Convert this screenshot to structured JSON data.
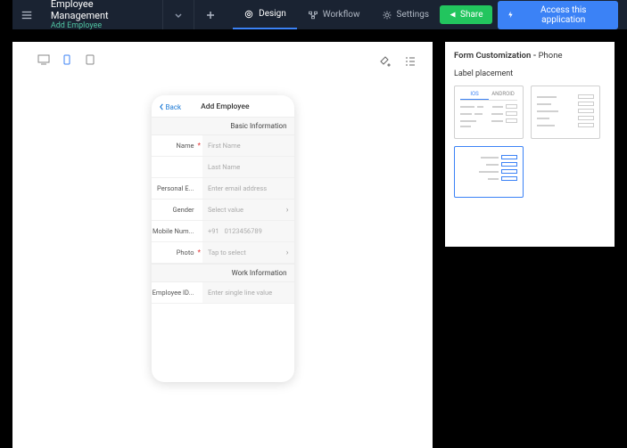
{
  "header": {
    "app_title": "Employee Management",
    "app_subtitle": "Add Employee",
    "tabs": {
      "design": "Design",
      "workflow": "Workflow",
      "settings": "Settings"
    },
    "share": "Share",
    "access": "Access this application"
  },
  "panel": {
    "title_prefix": "Form Customization - ",
    "title_context": "Phone",
    "label_placement": "Label placement",
    "tabs": {
      "ios": "IOS",
      "android": "ANDROID"
    }
  },
  "phone": {
    "back": "Back",
    "title": "Add Employee",
    "sections": {
      "basic": "Basic Information",
      "work": "Work Information"
    },
    "fields": {
      "name": {
        "label": "Name",
        "first_ph": "First Name",
        "last_ph": "Last Name"
      },
      "email": {
        "label": "Personal E...",
        "ph": "Enter email address"
      },
      "gender": {
        "label": "Gender",
        "ph": "Select value"
      },
      "mobile": {
        "label": "Mobile Num...",
        "code": "+91",
        "ph": "0123456789"
      },
      "photo": {
        "label": "Photo",
        "ph": "Tap to select"
      },
      "empid": {
        "label": "Employee ID...",
        "ph": "Enter single line value"
      }
    }
  }
}
